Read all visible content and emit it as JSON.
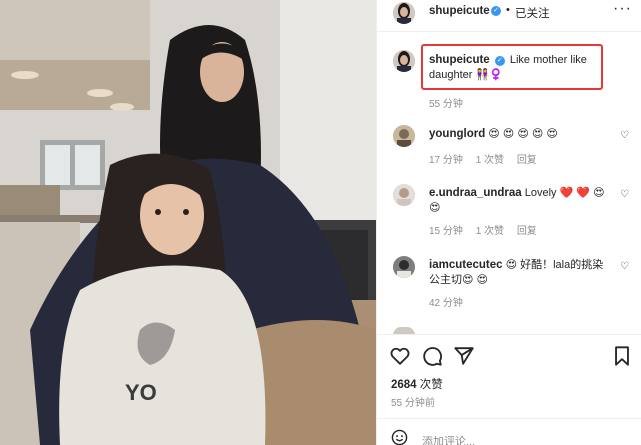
{
  "post": {
    "author": "shupeicute",
    "dot": "•",
    "follow_status": "已关注",
    "more": "···",
    "caption_text": "Like mother like daughter 👭♀️",
    "caption_time": "55 分钟"
  },
  "comments": [
    {
      "username": "younglord",
      "text": "😍 😍 😍 😍 😍",
      "time": "17 分钟",
      "likes": "1 次赞",
      "reply": "回复"
    },
    {
      "username": "e.undraa_undraa",
      "text": "Lovely ❤️ ❤️ 😍 😍",
      "time": "15 分钟",
      "likes": "1 次赞",
      "reply": "回复"
    },
    {
      "username": "iamcutecutec",
      "text": "😍 好酷！lala的挑染 公主切😍 😍",
      "time": "42 分钟",
      "likes": "",
      "reply": ""
    }
  ],
  "likes_count": "2684",
  "likes_unit": "次赞",
  "posted_ago": "55 分钟前",
  "add_comment_placeholder": "添加评论...",
  "colors": {
    "highlight": "#e53935",
    "verified": "#3897f0",
    "meta": "#8e8e8e"
  },
  "icons": {
    "like": "heart-outline-icon",
    "comment": "speech-bubble-icon",
    "share": "paper-plane-icon",
    "save": "bookmark-icon",
    "emoji": "smiley-icon",
    "more": "more-dots-icon",
    "verified": "verified-badge-icon"
  }
}
